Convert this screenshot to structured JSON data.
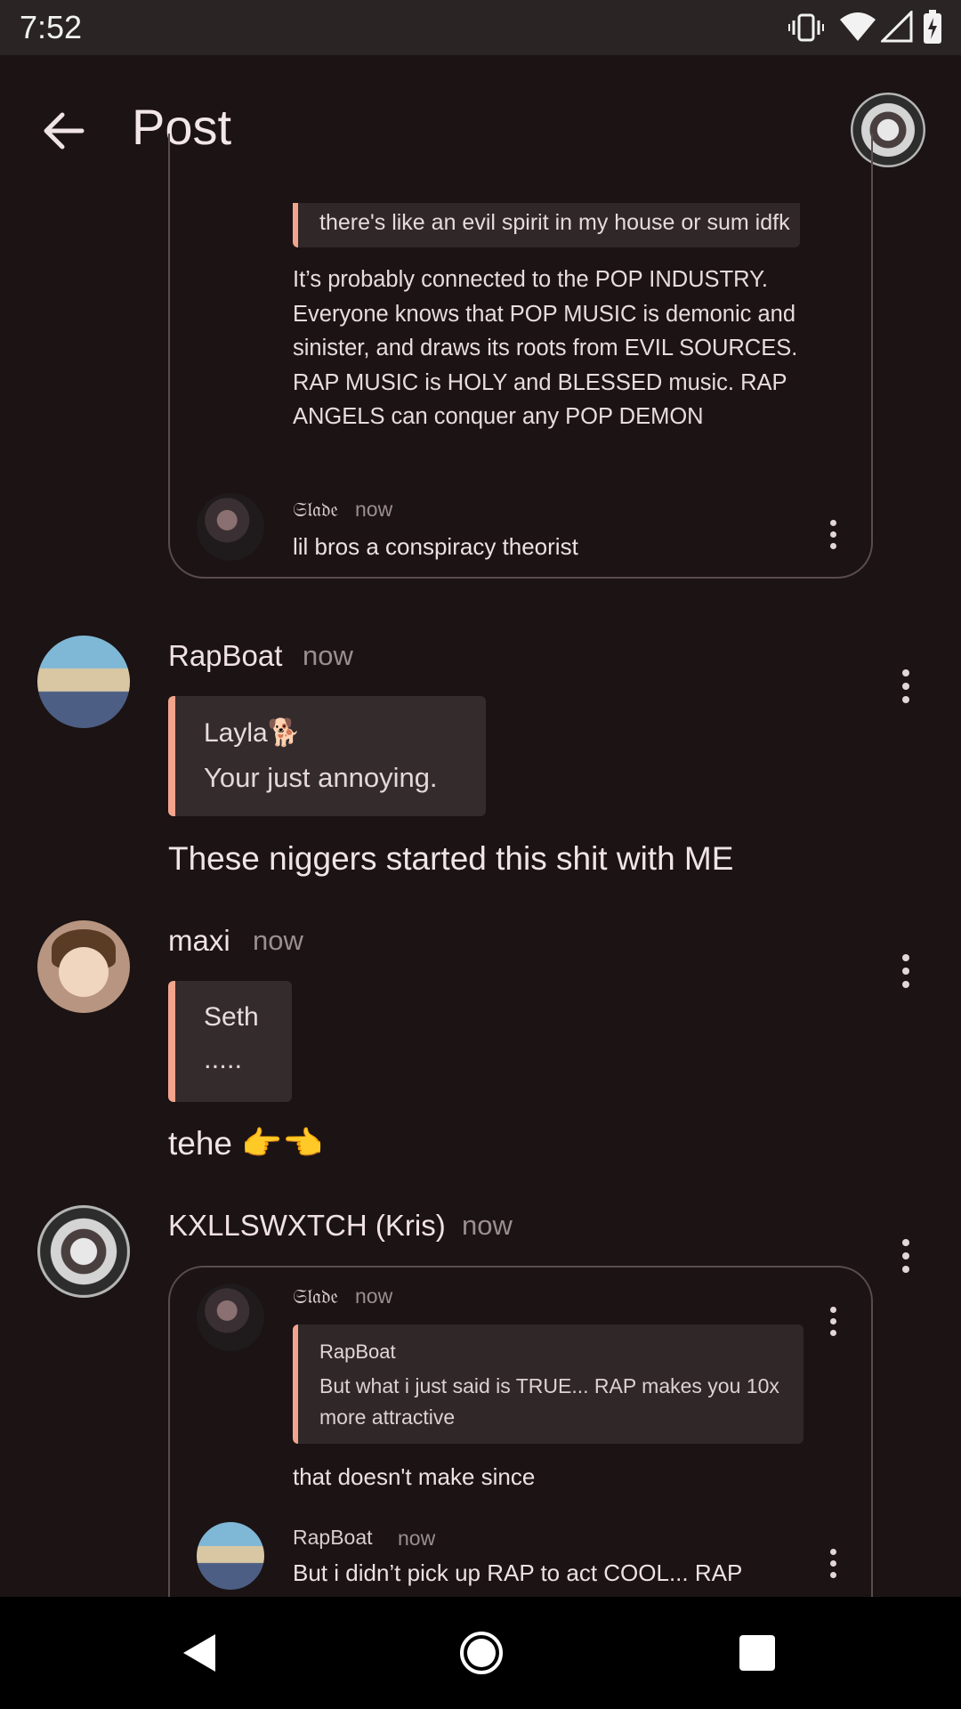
{
  "status_bar": {
    "time": "7:52"
  },
  "app_bar": {
    "title": "Post"
  },
  "top_card": {
    "quote_text": "there's like an evil spirit in my house or sum idfk",
    "body": "It’s probably connected to the POP INDUSTRY. Everyone knows that POP MUSIC is demonic and sinister, and draws its roots from EVIL SOURCES. RAP MUSIC is HOLY and BLESSED music. RAP ANGELS can conquer any POP DEMON",
    "reply": {
      "user": "𝔖𝔩𝔞𝔡𝔢",
      "time": "now",
      "text": "lil bros a conspiracy theorist"
    }
  },
  "comments": [
    {
      "user": "RapBoat",
      "time": "now",
      "quote_user": "Layla🐕",
      "quote_text": "Your just annoying.",
      "body": "These niggers started this shit with ME"
    },
    {
      "user": "maxi",
      "time": "now",
      "quote_user": "Seth",
      "quote_text": ".....",
      "body": "tehe 👉👈"
    },
    {
      "user": "KXLLSWXTCH (Kris)",
      "time": "now",
      "nested": [
        {
          "user": "𝔖𝔩𝔞𝔡𝔢",
          "time": "now",
          "quote_user": "RapBoat",
          "quote_text": "But what i just said is TRUE... RAP makes you 10x more attractive",
          "text": "that doesn't make since"
        },
        {
          "user": "RapBoat",
          "time": "now",
          "text": "But i didn’t pick up RAP to act COOL... RAP"
        }
      ]
    }
  ],
  "icons": {
    "back": "arrow-left-icon",
    "vibrate": "vibrate-icon",
    "wifi": "wifi-icon",
    "signal": "signal-icon",
    "battery": "battery-charging-icon",
    "more": "more-vertical-icon",
    "nav_back": "nav-back-icon",
    "nav_home": "nav-home-icon",
    "nav_recents": "nav-recents-icon"
  }
}
